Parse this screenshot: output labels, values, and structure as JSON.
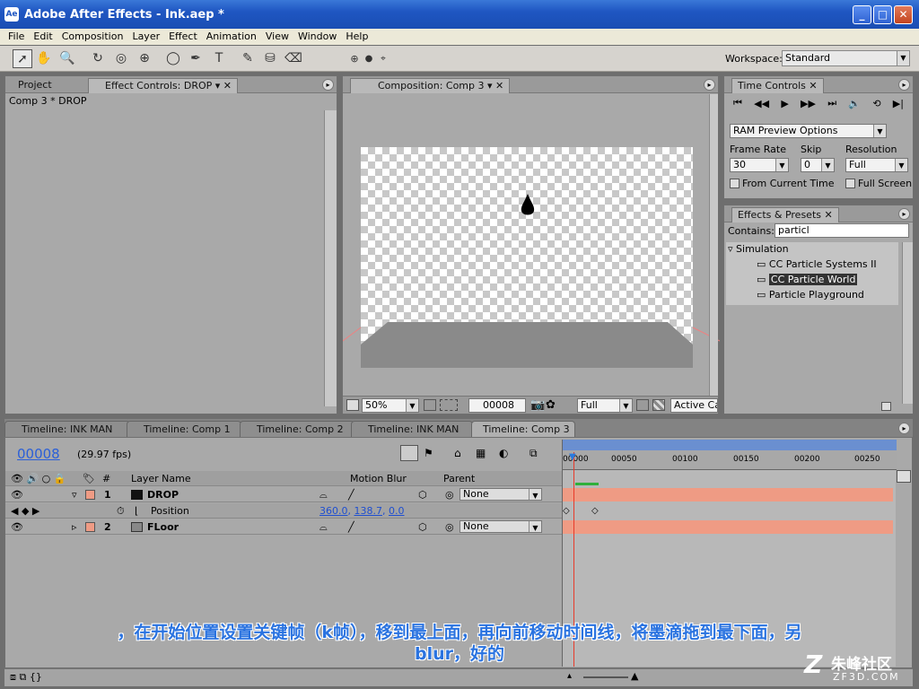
{
  "app": {
    "title": "Adobe After Effects - Ink.aep *"
  },
  "menu": [
    "File",
    "Edit",
    "Composition",
    "Layer",
    "Effect",
    "Animation",
    "View",
    "Window",
    "Help"
  ],
  "toolbar": {
    "workspace_label": "Workspace:",
    "workspace_value": "Standard"
  },
  "project_panel": {
    "tab_project": "Project",
    "tab_effect": "Effect Controls: DROP",
    "breadcrumb": "Comp 3 * DROP"
  },
  "comp_panel": {
    "tab": "Composition: Comp 3",
    "zoom": "50%",
    "timecode": "00008",
    "resolution": "Full",
    "camera": "Active Ca"
  },
  "time_controls": {
    "tab": "Time Controls",
    "preview_select": "RAM Preview Options",
    "frame_rate_label": "Frame Rate",
    "skip_label": "Skip",
    "resolution_label": "Resolution",
    "frame_rate": "30",
    "skip": "0",
    "resolution": "Full",
    "from_current": "From Current Time",
    "full_screen": "Full Screen"
  },
  "effects_presets": {
    "tab": "Effects & Presets",
    "contains_label": "Contains:",
    "search_value": "particl",
    "group": "Simulation",
    "items": [
      "CC Particle Systems II",
      "CC Particle World",
      "Particle Playground"
    ]
  },
  "timeline": {
    "tabs": [
      "Timeline: INK MAN",
      "Timeline: Comp 1",
      "Timeline: Comp 2",
      "Timeline: INK MAN",
      "Timeline: Comp 3"
    ],
    "timecode": "00008",
    "fps": "(29.97 fps)",
    "col_num": "#",
    "col_layer": "Layer Name",
    "col_motion": "Motion Blur",
    "col_parent": "Parent",
    "ruler": [
      "00000",
      "00050",
      "00100",
      "00150",
      "00200",
      "00250"
    ],
    "layers": [
      {
        "num": "1",
        "name": "DROP",
        "parent": "None"
      },
      {
        "num": "2",
        "name": "FLoor",
        "parent": "None"
      }
    ],
    "position_label": "Position",
    "position_value_x": "360.0",
    "position_value_y": "138.7",
    "position_value_z": "0.0"
  },
  "subtitle": {
    "line1": "，在开始位置设置关键帧（k帧），移到最上面，再向前移动时间线，将墨滴拖到最下面，另",
    "line2": "blur，好的"
  },
  "watermark": {
    "cn": "朱峰社区",
    "url": "ZF3D.COM"
  },
  "colors": {
    "title_bar": "#1f56c2",
    "layer_bar": "#ef9b84",
    "cti": "#e83a2a",
    "timecode": "#2a5fd8"
  }
}
